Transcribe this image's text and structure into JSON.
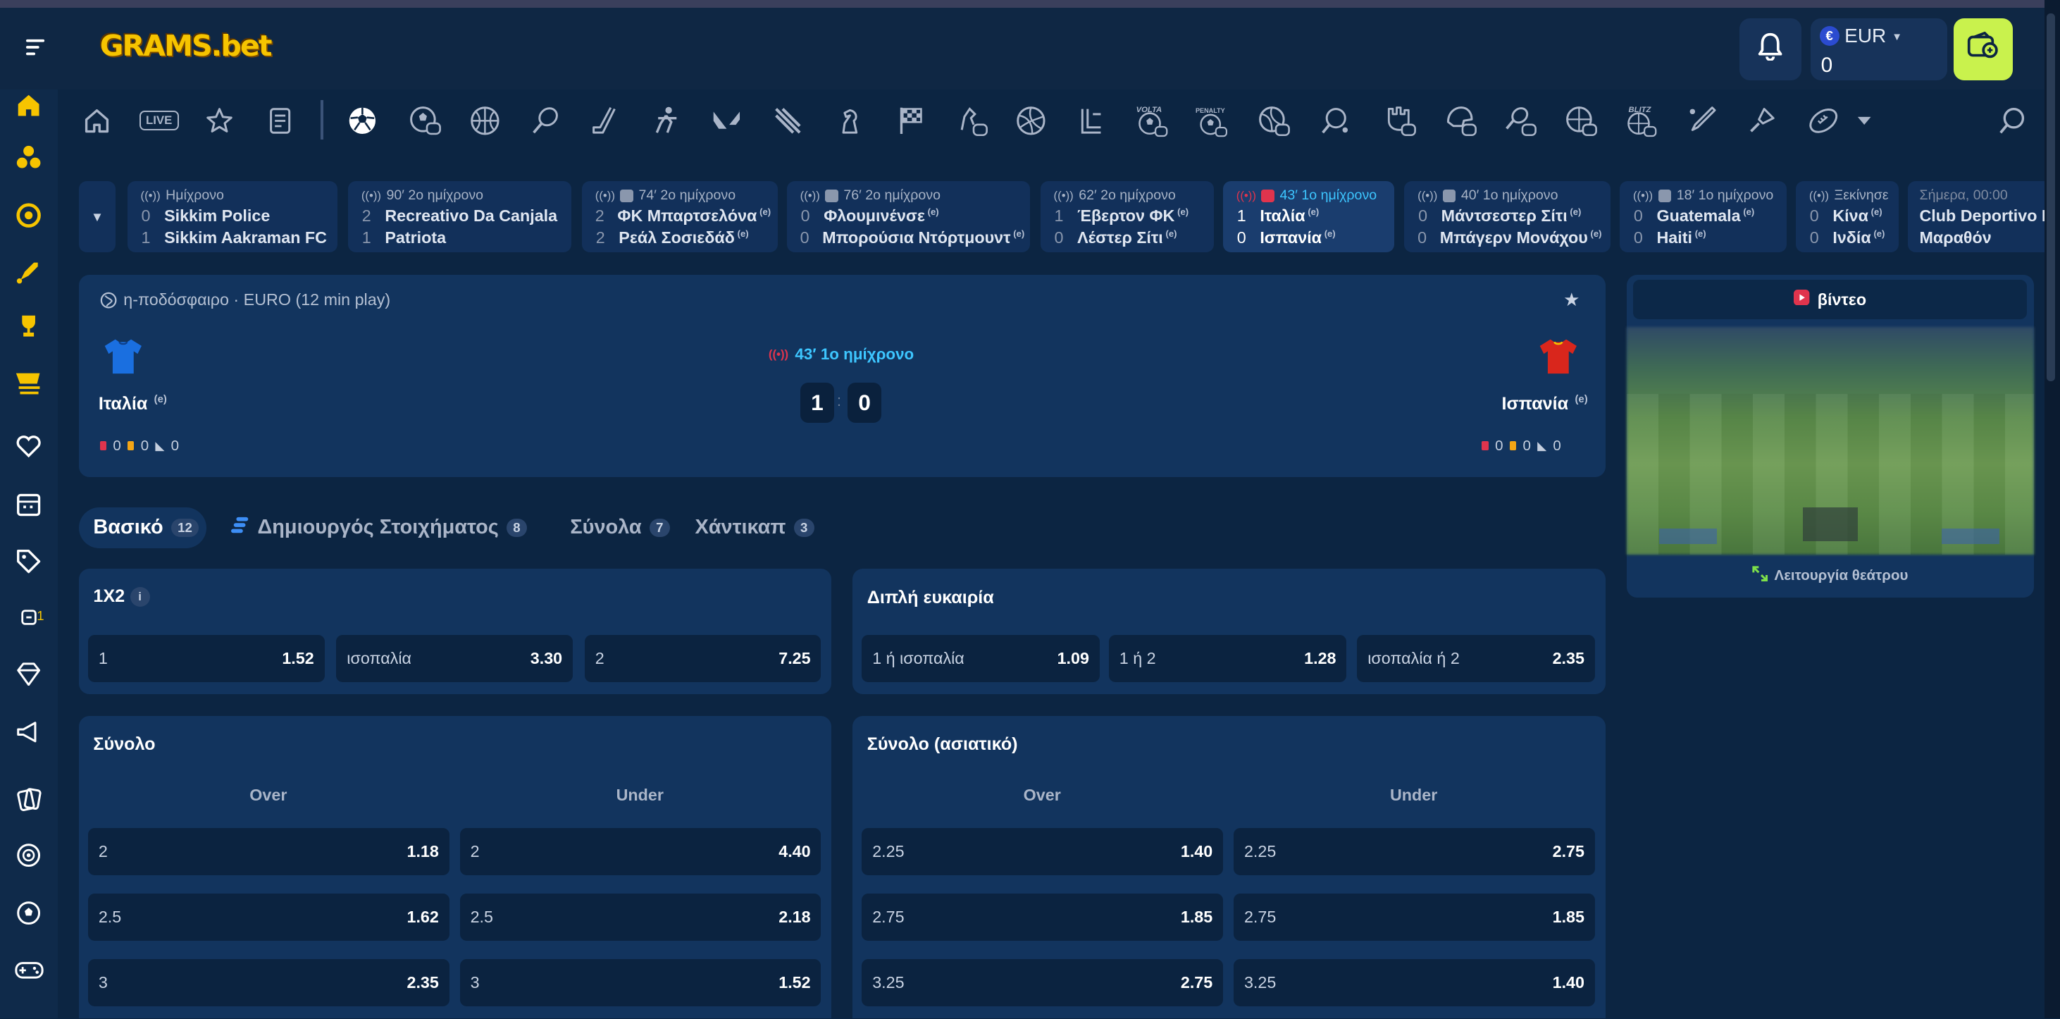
{
  "header": {
    "logo_text": "GRAMS.bet",
    "currency": "EUR",
    "currency_symbol": "€",
    "balance": "0"
  },
  "sidebar": {
    "items": [
      {
        "icon": "home-icon"
      },
      {
        "icon": "casino-chips-icon"
      },
      {
        "icon": "target-icon"
      },
      {
        "icon": "rocket-icon"
      },
      {
        "icon": "trophy-icon"
      },
      {
        "icon": "shop-cart-icon"
      },
      {
        "icon": "heart-icon"
      },
      {
        "icon": "calendar-icon"
      },
      {
        "icon": "tag-icon"
      },
      {
        "icon": "coupon-icon",
        "badge": "1"
      },
      {
        "icon": "diamond-icon"
      },
      {
        "icon": "megaphone-icon"
      },
      {
        "icon": "cards-icon"
      },
      {
        "icon": "roulette-icon"
      },
      {
        "icon": "football-icon"
      },
      {
        "icon": "gamepad-icon"
      }
    ]
  },
  "sports_nav": {
    "live_label": "LIVE",
    "volta_label": "VOLTA",
    "penalty_label": "PENALTY",
    "blitz_label": "BLITZ"
  },
  "matches": [
    {
      "status": "Ημίχρονο",
      "home_score": "0",
      "home": "Sikkim Police",
      "away_score": "1",
      "away": "Sikkim Aakraman FC"
    },
    {
      "status": "90′ 2ο ημίχρονο",
      "home_score": "2",
      "home": "Recreativo Da Canjala",
      "away_score": "1",
      "away": "Patriota"
    },
    {
      "status": "74′ 2ο ημίχρονο",
      "home_score": "2",
      "home": "ΦΚ Μπαρτσελόνα",
      "away_score": "2",
      "away": "Ρεάλ Σοσιεδάδ"
    },
    {
      "status": "76′ 2ο ημίχρονο",
      "home_score": "0",
      "home": "Φλουμινένσε",
      "away_score": "0",
      "away": "Μπορούσια Ντόρτμουντ"
    },
    {
      "status": "62′ 2ο ημίχρονο",
      "home_score": "1",
      "home": "Έβερτον ΦΚ",
      "away_score": "0",
      "away": "Λέστερ Σίτι"
    },
    {
      "status": "43′ 1ο ημίχρονο",
      "home_score": "1",
      "home": "Ιταλία",
      "away_score": "0",
      "away": "Ισπανία"
    },
    {
      "status": "40′ 1ο ημίχρονο",
      "home_score": "0",
      "home": "Μάντσεστερ Σίτι",
      "away_score": "0",
      "away": "Μπάγερν Μονάχου"
    },
    {
      "status": "18′ 1ο ημίχρονο",
      "home_score": "0",
      "home": "Guatemala",
      "away_score": "0",
      "away": "Haiti"
    },
    {
      "status": "Ξεκίνησε",
      "home_score": "0",
      "home": "Κίνα",
      "away_score": "0",
      "away": "Ινδία"
    },
    {
      "status": "Σήμερα, 00:00",
      "home": "Club Deportivo P",
      "away": "Μαραθόν"
    }
  ],
  "esports_suffix": "(e)",
  "event": {
    "competition": "η-ποδόσφαιρο · EURO (12 min play)",
    "time": "43′ 1ο ημίχρονο",
    "home": "Ιταλία",
    "away": "Ισπανία",
    "home_score": "1",
    "away_score": "0",
    "separator": ":",
    "home_stats": {
      "red": "0",
      "yellow": "0",
      "corners": "0"
    },
    "away_stats": {
      "red": "0",
      "yellow": "0",
      "corners": "0"
    }
  },
  "video": {
    "button_label": "βίντεο",
    "theatre_label": "Λειτουργία θεάτρου"
  },
  "tabs": [
    {
      "label": "Βασικό",
      "count": "12"
    },
    {
      "label": "Δημιουργός Στοιχήματος",
      "count": "8"
    },
    {
      "label": "Σύνολα",
      "count": "7"
    },
    {
      "label": "Χάντικαπ",
      "count": "3"
    }
  ],
  "markets": {
    "x12": {
      "title": "1X2",
      "info": "i",
      "odds": [
        {
          "label": "1",
          "value": "1.52"
        },
        {
          "label": "ισοπαλία",
          "value": "3.30"
        },
        {
          "label": "2",
          "value": "7.25"
        }
      ]
    },
    "double_chance": {
      "title": "Διπλή ευκαιρία",
      "odds": [
        {
          "label": "1 ή ισοπαλία",
          "value": "1.09"
        },
        {
          "label": "1 ή 2",
          "value": "1.28"
        },
        {
          "label": "ισοπαλία ή 2",
          "value": "2.35"
        }
      ]
    },
    "total": {
      "title": "Σύνολο",
      "over_label": "Over",
      "under_label": "Under",
      "rows": [
        {
          "line": "2",
          "over": "1.18",
          "under": "4.40"
        },
        {
          "line": "2.5",
          "over": "1.62",
          "under": "2.18"
        },
        {
          "line": "3",
          "over": "2.35",
          "under": "1.52"
        }
      ]
    },
    "asian_total": {
      "title": "Σύνολο (ασιατικό)",
      "over_label": "Over",
      "under_label": "Under",
      "rows": [
        {
          "line": "2.25",
          "over": "1.40",
          "under": "2.75"
        },
        {
          "line": "2.75",
          "over": "1.85",
          "under": "1.85"
        },
        {
          "line": "3.25",
          "over": "2.75",
          "under": "1.40"
        }
      ]
    }
  },
  "colors": {
    "accent_live": "#3dc6ff",
    "cashier": "#c9f24d",
    "logo": "#f6c400",
    "background": "#0c2542"
  }
}
